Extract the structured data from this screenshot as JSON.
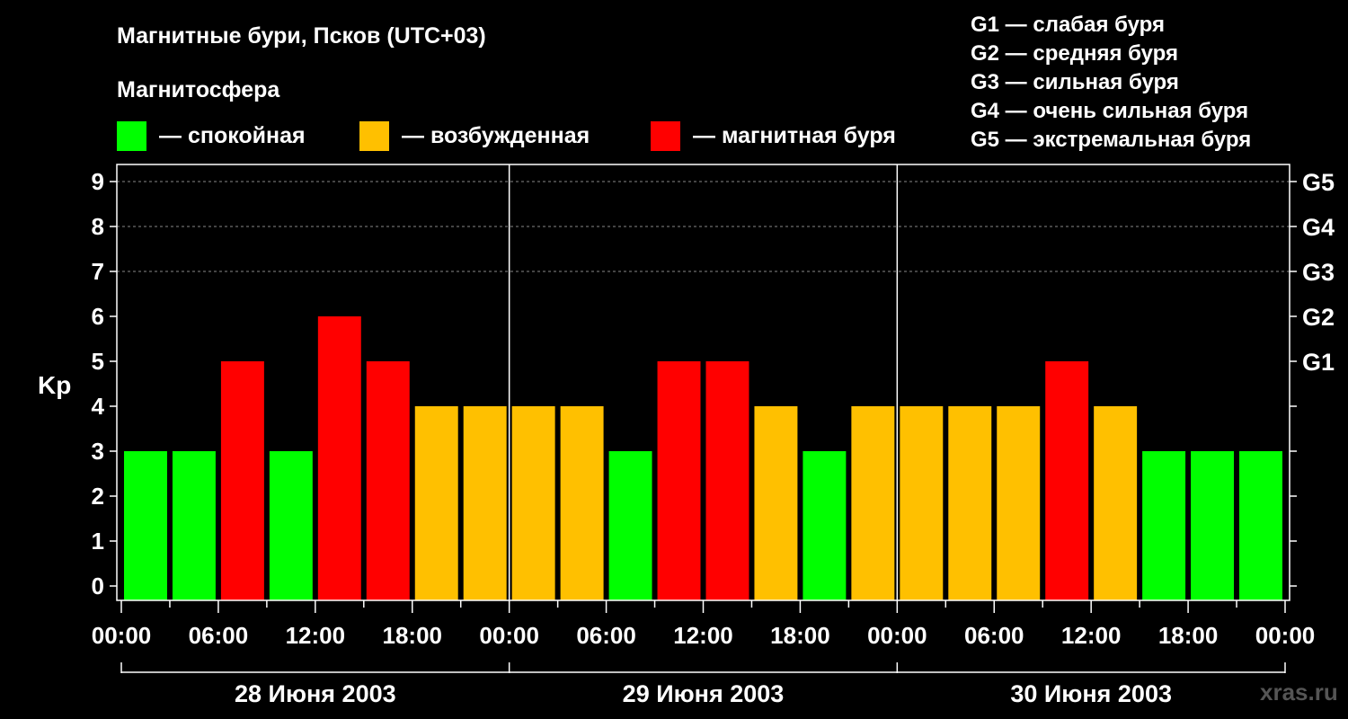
{
  "title": "Магнитные бури, Псков (UTC+03)",
  "magnetosphere": {
    "heading": "Магнитосфера",
    "items": [
      {
        "label": "— спокойная",
        "color": "#00ff00"
      },
      {
        "label": "— возбужденная",
        "color": "#ffc000"
      },
      {
        "label": "— магнитная буря",
        "color": "#ff0000"
      }
    ]
  },
  "storm_scale": [
    "G1 — слабая буря",
    "G2 — средняя буря",
    "G3 — сильная буря",
    "G4 — очень сильная буря",
    "G5 — экстремальная буря"
  ],
  "watermark": "xras.ru",
  "chart_data": {
    "type": "bar",
    "ylabel": "Kp",
    "ylim": [
      0,
      9
    ],
    "yticks": [
      0,
      1,
      2,
      3,
      4,
      5,
      6,
      7,
      8,
      9
    ],
    "right_ticks": [
      {
        "value": 5,
        "label": "G1"
      },
      {
        "value": 6,
        "label": "G2"
      },
      {
        "value": 7,
        "label": "G3"
      },
      {
        "value": 8,
        "label": "G4"
      },
      {
        "value": 9,
        "label": "G5"
      }
    ],
    "x_tick_labels": [
      "00:00",
      "06:00",
      "12:00",
      "18:00",
      "00:00",
      "06:00",
      "12:00",
      "18:00",
      "00:00",
      "06:00",
      "12:00",
      "18:00",
      "00:00"
    ],
    "days": [
      "28 Июня 2003",
      "29 Июня 2003",
      "30 Июня 2003"
    ],
    "grid": "dashed horizontal at 7, 8, 9",
    "interval_hours": 3,
    "values": [
      3,
      3,
      5,
      3,
      6,
      5,
      4,
      4,
      4,
      4,
      3,
      5,
      5,
      4,
      3,
      4,
      4,
      4,
      4,
      5,
      4,
      3,
      3,
      3
    ],
    "color_rule": {
      "quiet_max": 3,
      "active": 4,
      "storm_min": 5
    },
    "colors": {
      "quiet": "#00ff00",
      "active": "#ffc000",
      "storm": "#ff0000"
    }
  }
}
